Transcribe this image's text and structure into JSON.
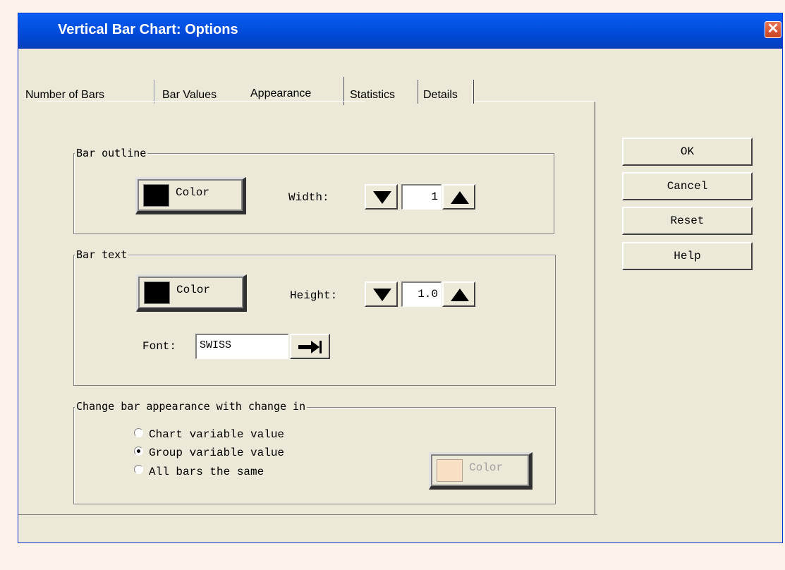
{
  "window": {
    "title": "Vertical Bar Chart: Options"
  },
  "tabs": [
    {
      "label": "Number of Bars",
      "active": false
    },
    {
      "label": "Bar Values",
      "active": false
    },
    {
      "label": "Appearance",
      "active": true
    },
    {
      "label": "Statistics",
      "active": false
    },
    {
      "label": "Details",
      "active": false
    }
  ],
  "bar_outline": {
    "legend": "Bar outline",
    "color_label": "Color",
    "width_label": "Width:",
    "width_value": "1"
  },
  "bar_text": {
    "legend": "Bar text",
    "color_label": "Color",
    "height_label": "Height:",
    "height_value": "1.0",
    "font_label": "Font:",
    "font_value": "SWISS"
  },
  "appearance_change": {
    "legend": "Change bar appearance with change in",
    "options": [
      {
        "label": "Chart variable value",
        "selected": false
      },
      {
        "label": "Group variable value",
        "selected": true
      },
      {
        "label": "All bars the same",
        "selected": false
      }
    ],
    "color_label": "Color",
    "color_enabled": false
  },
  "buttons": {
    "ok": "OK",
    "cancel": "Cancel",
    "reset": "Reset",
    "help": "Help"
  },
  "colors": {
    "titlebar": "#0454e4",
    "dialog_bg": "#ece9d8",
    "outline_swatch": "#000000",
    "text_swatch": "#000000",
    "disabled_swatch": "#f9dfc4"
  }
}
